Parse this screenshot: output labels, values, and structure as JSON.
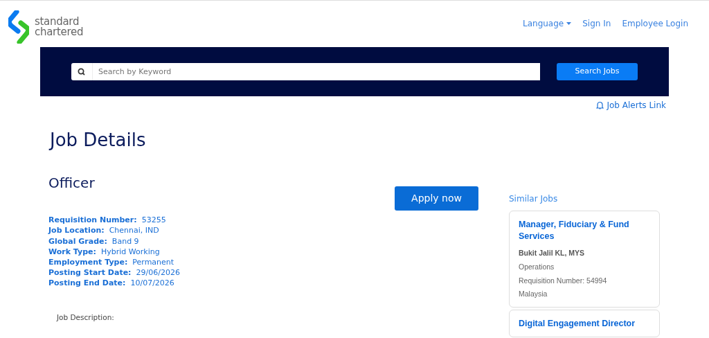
{
  "logo": {
    "lines": [
      "standard",
      "chartered"
    ]
  },
  "nav": [
    {
      "label": "Language",
      "kind": "dropdown"
    },
    {
      "label": "Sign In",
      "kind": "link"
    },
    {
      "label": "Employee Login",
      "kind": "link"
    }
  ],
  "search": {
    "placeholder": "Search by Keyword",
    "button": "Search Jobs"
  },
  "job_alerts": "Job Alerts Link",
  "page_title": "Job Details",
  "job_title": "Officer",
  "apply_button": "Apply now",
  "details": [
    {
      "label": "Requisition Number:",
      "value": "53255"
    },
    {
      "label": "Job Location:",
      "value": "Chennai, IND"
    },
    {
      "label": "Global Grade:",
      "value": "Band 9"
    },
    {
      "label": "Work Type:",
      "value": "Hybrid Working"
    },
    {
      "label": "Employment Type:",
      "value": "Permanent"
    },
    {
      "label": "Posting Start Date:",
      "value": "29/06/2026"
    },
    {
      "label": "Posting End Date:",
      "value": "10/07/2026"
    }
  ],
  "description_heading": "Job Description:",
  "similar_jobs": {
    "heading": "Similar Jobs",
    "items": [
      {
        "title": "Manager, Fiduciary & Fund Services",
        "location": "Bukit Jalil KL, MYS",
        "lines": [
          "Operations",
          "Requisition Number: 54994",
          "Malaysia"
        ]
      },
      {
        "title": "Digital Engagement Director"
      }
    ]
  }
}
